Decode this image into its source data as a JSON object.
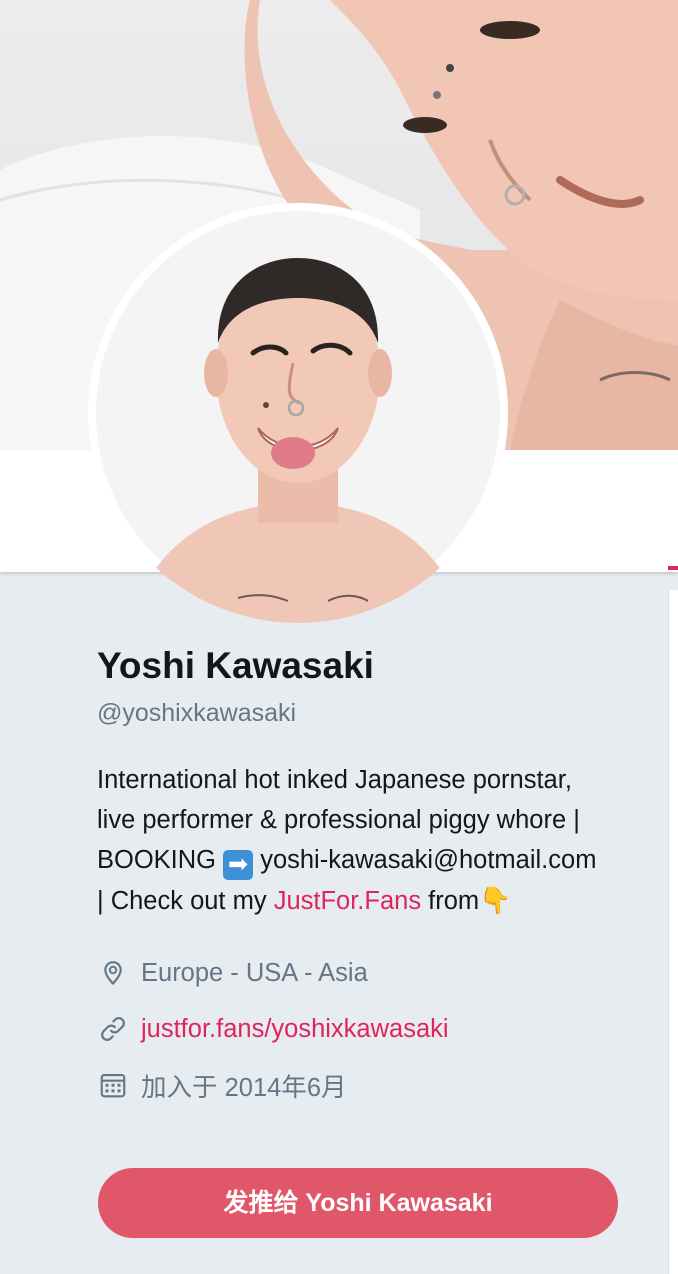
{
  "profile": {
    "display_name": "Yoshi Kawasaki",
    "handle": "@yoshixkawasaki",
    "bio": {
      "part1": "International hot inked Japanese pornstar, live performer & professional piggy whore | BOOKING ",
      "arrow_emoji": "➡",
      "part2": " yoshi-kawasaki@hotmail.com | Check out my ",
      "link_text": "JustFor.Fans",
      "part3": " from",
      "hand_emoji": "👇"
    },
    "location": "Europe - USA - Asia",
    "website": "justfor.fans/yoshixkawasaki",
    "joined": "加入于 2014年6月"
  },
  "actions": {
    "tweet_to_label": "发推给 Yoshi Kawasaki"
  },
  "colors": {
    "accent_red": "#e0245e",
    "button_red": "#e0576a",
    "muted_text": "#657786",
    "page_bg": "#e6ecf0"
  },
  "icons": {
    "location": "map-pin-icon",
    "website": "link-icon",
    "joined": "calendar-icon"
  }
}
